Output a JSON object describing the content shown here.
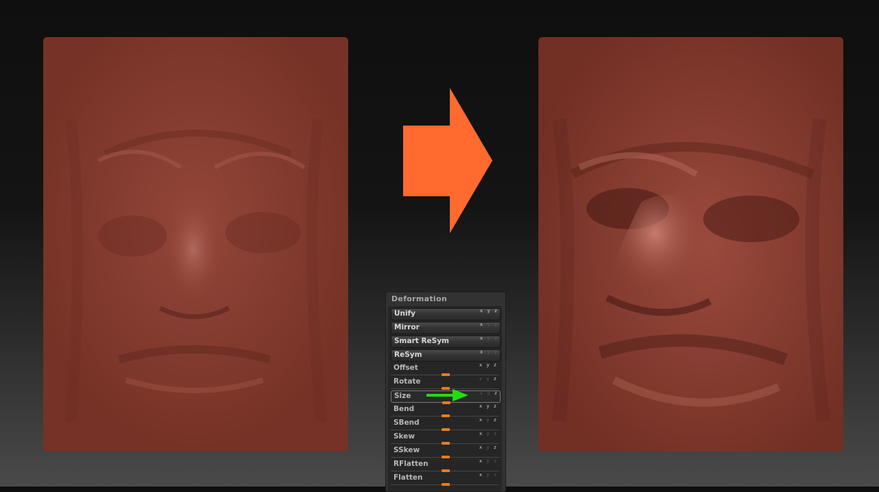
{
  "arrow_color": "#ff6a2e",
  "deformation": {
    "title": "Deformation",
    "items": [
      {
        "label": "Unify",
        "type": "button",
        "axes": "x y z",
        "active": [
          true,
          true,
          true
        ]
      },
      {
        "label": "Mirror",
        "type": "button",
        "axes": "x y z",
        "active": [
          true,
          false,
          false
        ]
      },
      {
        "label": "Smart ReSym",
        "type": "button",
        "axes": "x y z",
        "active": [
          true,
          false,
          false
        ]
      },
      {
        "label": "ReSym",
        "type": "button",
        "axes": "x y z",
        "active": [
          true,
          false,
          false
        ]
      },
      {
        "label": "Offset",
        "type": "slider",
        "axes": "x y z",
        "active": [
          true,
          true,
          true
        ]
      },
      {
        "label": "Rotate",
        "type": "slider",
        "axes": "x y z",
        "active": [
          false,
          false,
          true
        ]
      },
      {
        "label": "Size",
        "type": "slider",
        "axes": "x y z",
        "active": [
          false,
          false,
          true
        ]
      },
      {
        "label": "Bend",
        "type": "slider",
        "axes": "x y z",
        "active": [
          true,
          true,
          true
        ]
      },
      {
        "label": "SBend",
        "type": "slider",
        "axes": "x y z",
        "active": [
          true,
          false,
          true
        ]
      },
      {
        "label": "Skew",
        "type": "slider",
        "axes": "x y z",
        "active": [
          true,
          false,
          false
        ]
      },
      {
        "label": "SSkew",
        "type": "slider",
        "axes": "x y z",
        "active": [
          true,
          false,
          true
        ]
      },
      {
        "label": "RFlatten",
        "type": "slider",
        "axes": "x y z",
        "active": [
          true,
          false,
          false
        ]
      },
      {
        "label": "Flatten",
        "type": "slider",
        "axes": "x y z",
        "active": [
          true,
          false,
          false
        ]
      }
    ]
  },
  "highlight_arrow_color": "#22dd11",
  "sculpt_color": "#7a3528"
}
